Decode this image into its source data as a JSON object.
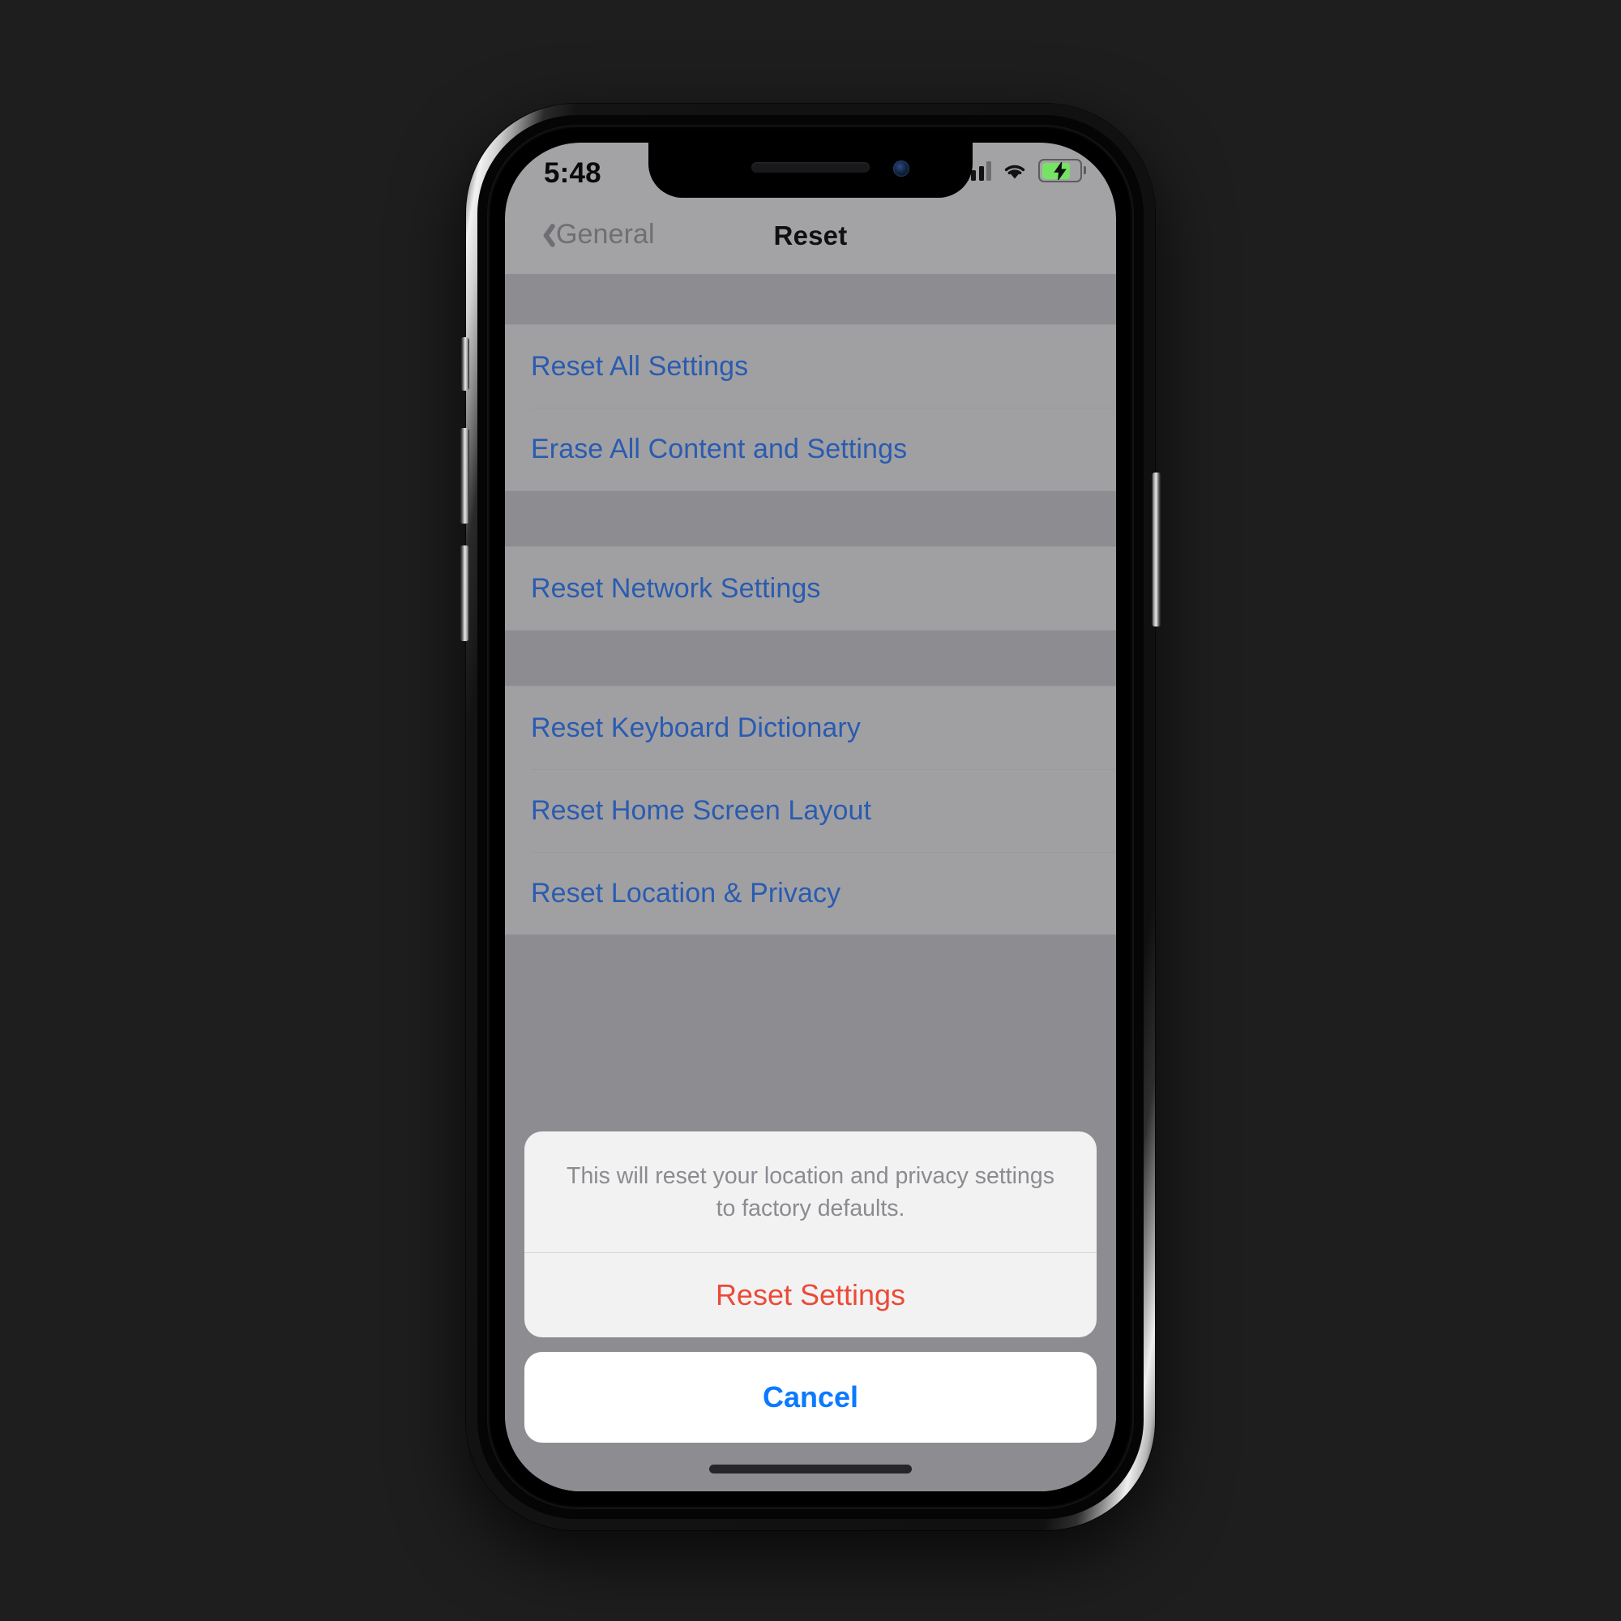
{
  "device": {
    "notch": {
      "speaker_icon": "speaker-grille-icon",
      "camera_icon": "front-camera-icon"
    },
    "buttons": {
      "mute_switch": "mute-switch",
      "volume_up": "volume-up-button",
      "volume_down": "volume-down-button",
      "power": "power-button"
    },
    "home_indicator": "home-indicator"
  },
  "status_bar": {
    "time": "5:48",
    "cellular_icon": "cellular-signal-icon",
    "cellular_bars_filled": 3,
    "cellular_bars_total": 4,
    "wifi_icon": "wifi-icon",
    "battery_icon": "battery-charging-icon",
    "battery_charging": true,
    "battery_color": "#76e364"
  },
  "nav": {
    "back_icon": "chevron-left-icon",
    "back_label": "General",
    "title": "Reset"
  },
  "list": {
    "link_color": "#2a5bb0",
    "sections": [
      {
        "items": [
          {
            "label": "Reset All Settings"
          },
          {
            "label": "Erase All Content and Settings"
          }
        ]
      },
      {
        "items": [
          {
            "label": "Reset Network Settings"
          }
        ]
      },
      {
        "items": [
          {
            "label": "Reset Keyboard Dictionary"
          },
          {
            "label": "Reset Home Screen Layout"
          },
          {
            "label": "Reset Location & Privacy"
          }
        ]
      }
    ]
  },
  "action_sheet": {
    "message": "This will reset your location and privacy settings to factory defaults.",
    "destructive_label": "Reset Settings",
    "destructive_color": "#ec4a38",
    "cancel_label": "Cancel",
    "cancel_color": "#0a7aff"
  }
}
